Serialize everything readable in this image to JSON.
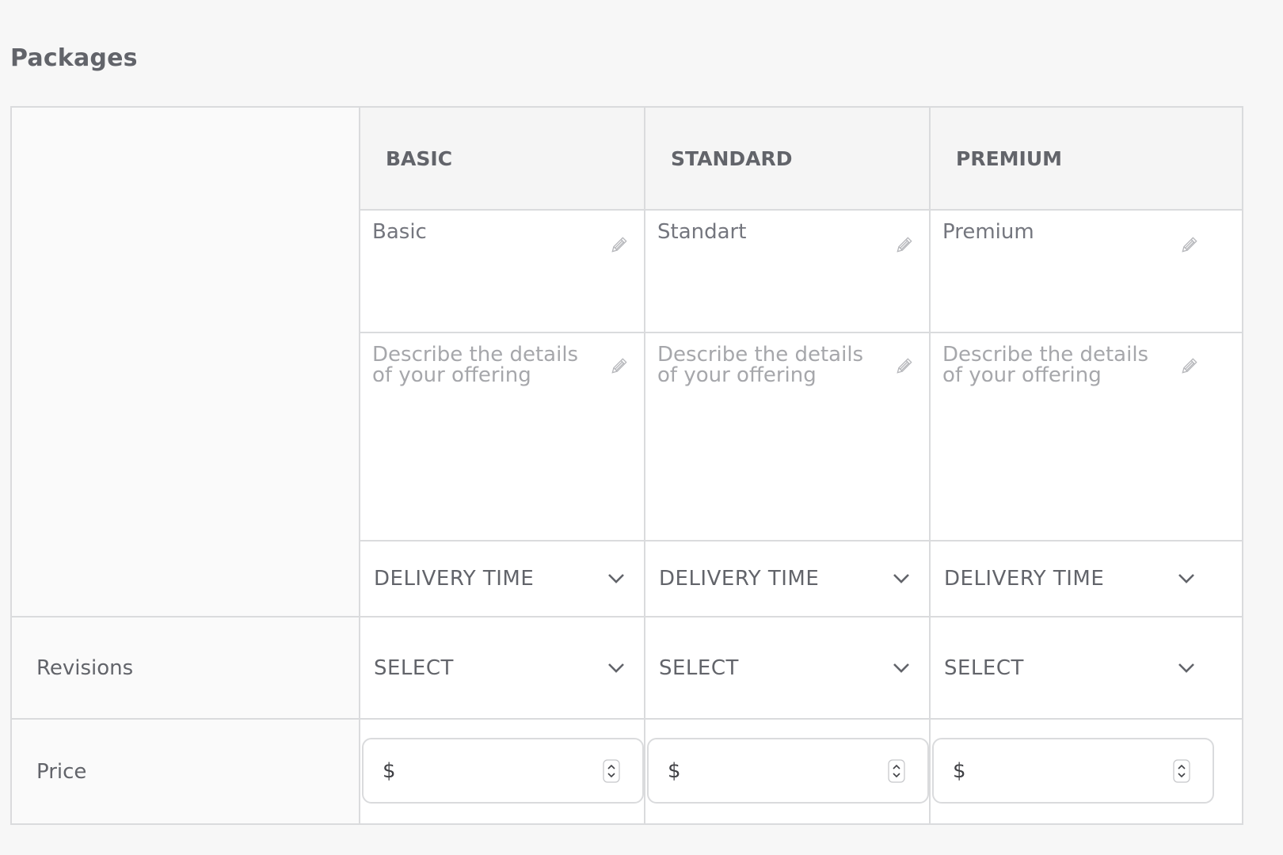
{
  "title": "Packages",
  "packages": [
    {
      "header": "BASIC",
      "name": "Basic",
      "description_placeholder": "Describe the details of your offering",
      "delivery": "DELIVERY TIME",
      "revisions": "SELECT",
      "price_prefix": "$"
    },
    {
      "header": "STANDARD",
      "name": "Standart",
      "description_placeholder": "Describe the details of your offering",
      "delivery": "DELIVERY TIME",
      "revisions": "SELECT",
      "price_prefix": "$"
    },
    {
      "header": "PREMIUM",
      "name": "Premium",
      "description_placeholder": "Describe the details of your offering",
      "delivery": "DELIVERY TIME",
      "revisions": "SELECT",
      "price_prefix": "$"
    }
  ],
  "rows": {
    "revisions_label": "Revisions",
    "price_label": "Price"
  },
  "icons": {
    "edit": "pencil-icon",
    "dropdown": "chevron-down-icon",
    "spinner": "number-spinner-icon"
  },
  "colors": {
    "header_bg": "#f5f5f5",
    "border": "#dadbdd",
    "text": "#62646a",
    "placeholder": "#a6a7ab"
  }
}
